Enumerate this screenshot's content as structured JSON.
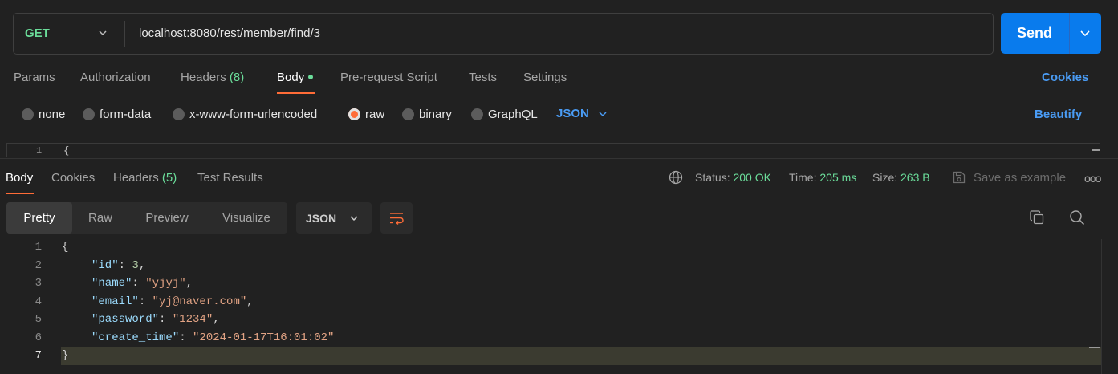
{
  "request": {
    "method": "GET",
    "url": "localhost:8080/rest/member/find/3",
    "send_label": "Send"
  },
  "request_tabs": {
    "params": "Params",
    "authorization": "Authorization",
    "headers": "Headers",
    "headers_count": "(8)",
    "body": "Body",
    "pre_request": "Pre-request Script",
    "tests": "Tests",
    "settings": "Settings",
    "cookies_link": "Cookies"
  },
  "body_types": {
    "none": "none",
    "form_data": "form-data",
    "urlencoded": "x-www-form-urlencoded",
    "raw": "raw",
    "binary": "binary",
    "graphql": "GraphQL",
    "selected": "raw",
    "language": "JSON",
    "beautify": "Beautify"
  },
  "request_editor": {
    "line": "1",
    "code": "{"
  },
  "response_tabs": {
    "body": "Body",
    "cookies": "Cookies",
    "headers": "Headers",
    "headers_count": "(5)",
    "test_results": "Test Results"
  },
  "response_meta": {
    "status_label": "Status:",
    "status_value": "200 OK",
    "time_label": "Time:",
    "time_value": "205 ms",
    "size_label": "Size:",
    "size_value": "263 B",
    "save_example": "Save as example",
    "more": "ooo"
  },
  "view": {
    "pretty": "Pretty",
    "raw": "Raw",
    "preview": "Preview",
    "visualize": "Visualize",
    "format": "JSON"
  },
  "response_code": {
    "line_numbers": [
      "1",
      "2",
      "3",
      "4",
      "5",
      "6",
      "7"
    ],
    "open": "{",
    "close": "}",
    "fields": [
      {
        "key": "\"id\"",
        "value": "3",
        "type": "number"
      },
      {
        "key": "\"name\"",
        "value": "\"yjyj\"",
        "type": "string"
      },
      {
        "key": "\"email\"",
        "value": "\"yj@naver.com\"",
        "type": "string"
      },
      {
        "key": "\"password\"",
        "value": "\"1234\"",
        "type": "string"
      },
      {
        "key": "\"create_time\"",
        "value": "\"2024-01-17T16:01:02\"",
        "type": "string"
      }
    ]
  },
  "colors": {
    "accent_orange": "#ff6c37",
    "send_blue": "#097bed",
    "link_blue": "#4a9cf5",
    "success_green": "#6bdd9a"
  }
}
